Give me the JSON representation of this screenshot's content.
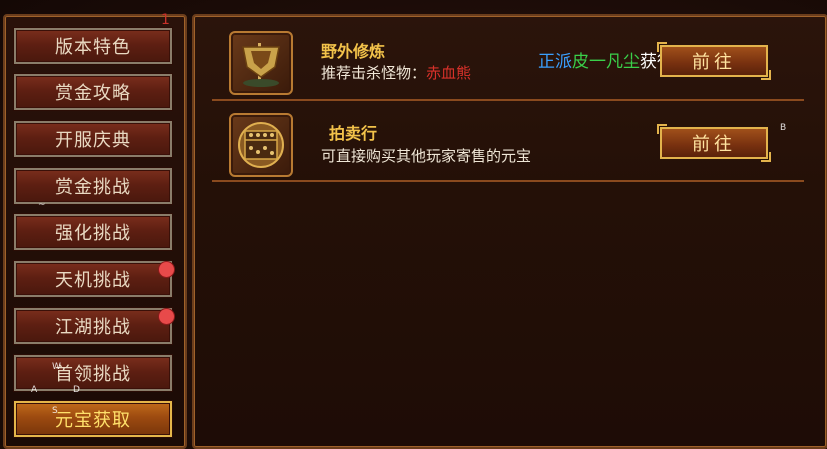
{
  "sidebar": {
    "corner_number": "1",
    "items": [
      {
        "label": "版本特色",
        "active": false,
        "dot": false
      },
      {
        "label": "赏金攻略",
        "active": false,
        "dot": false
      },
      {
        "label": "开服庆典",
        "active": false,
        "dot": false
      },
      {
        "label": "赏金挑战",
        "active": false,
        "dot": false
      },
      {
        "label": "强化挑战",
        "active": false,
        "dot": false
      },
      {
        "label": "天机挑战",
        "active": false,
        "dot": true
      },
      {
        "label": "江湖挑战",
        "active": false,
        "dot": true
      },
      {
        "label": "首领挑战",
        "active": false,
        "dot": false
      },
      {
        "label": "元宝获取",
        "active": true,
        "dot": false
      }
    ]
  },
  "overlay_hints": {
    "tilde": "~",
    "w": "W",
    "a": "A",
    "d": "D",
    "s": "S",
    "b": "B"
  },
  "notice": {
    "part1": "正派",
    "part2": "皮一凡尘",
    "part3": "获得"
  },
  "entries": [
    {
      "title": "野外修炼",
      "desc_prefix": "推荐击杀怪物：",
      "desc_monster": "赤血熊",
      "button": "前往",
      "icon": "banner-icon"
    },
    {
      "title": "拍卖行",
      "desc_prefix": "可直接购买其他玩家寄售的元宝",
      "button": "前往",
      "icon": "abacus-icon"
    }
  ],
  "colors": {
    "accent_gold": "#f2c24a",
    "monster_red": "#d8312a",
    "dot_red": "#e84a4a"
  }
}
